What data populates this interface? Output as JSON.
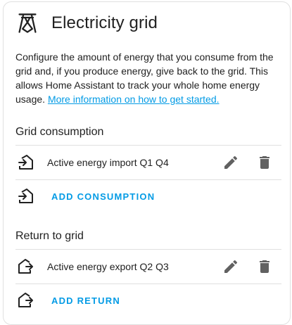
{
  "header": {
    "title": "Electricity grid",
    "icon": "transmission-tower-icon"
  },
  "description": {
    "text": "Configure the amount of energy that you consume from the grid and, if you produce energy, give back to the grid. This allows Home Assistant to track your whole home energy usage. ",
    "link_text": "More information on how to get started."
  },
  "consumption": {
    "title": "Grid consumption",
    "items": [
      {
        "label": "Active energy import Q1 Q4"
      }
    ],
    "add_label": "ADD CONSUMPTION"
  },
  "return": {
    "title": "Return to grid",
    "items": [
      {
        "label": "Active energy export Q2 Q3"
      }
    ],
    "add_label": "ADD RETURN"
  },
  "colors": {
    "accent": "#039be5",
    "icon": "#616161",
    "text": "#212121"
  }
}
